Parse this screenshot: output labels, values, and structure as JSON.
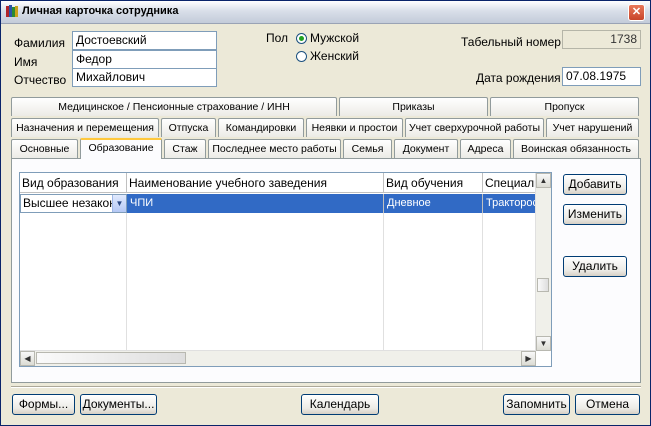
{
  "window": {
    "title": "Личная карточка сотрудника"
  },
  "personal": {
    "surname_label": "Фамилия",
    "surname": "Достоевский",
    "name_label": "Имя",
    "name": "Федор",
    "patronymic_label": "Отчество",
    "patronymic": "Михайлович"
  },
  "gender": {
    "label": "Пол",
    "male": "Мужской",
    "female": "Женский",
    "selected": "male"
  },
  "employee": {
    "number_label": "Табельный номер",
    "number": "1738",
    "birth_label": "Дата рождения",
    "birth_date": "07.08.1975"
  },
  "tabs": {
    "row1": [
      "Медицинское / Пенсионные страхование / ИНН",
      "Приказы",
      "Пропуск"
    ],
    "row2": [
      "Назначения и перемещения",
      "Отпуска",
      "Командировки",
      "Неявки и простои",
      "Учет сверхурочной работы",
      "Учет нарушений"
    ],
    "row3": [
      "Основные",
      "Образование",
      "Стаж",
      "Последнее место работы",
      "Семья",
      "Документ",
      "Адреса",
      "Воинская обязанность"
    ],
    "active": "Образование"
  },
  "education_grid": {
    "columns": [
      "Вид образования",
      "Наименование учебного заведения",
      "Вид обучения",
      "Специальн"
    ],
    "rows": [
      {
        "kind": "Высшее незакон.",
        "institution": "ЧПИ",
        "study_form": "Дневное",
        "specialty": "Тракторос"
      }
    ]
  },
  "side_buttons": {
    "add": "Добавить",
    "edit": "Изменить",
    "delete": "Удалить"
  },
  "footer": {
    "forms": "Формы...",
    "documents": "Документы...",
    "calendar": "Календарь",
    "save": "Запомнить",
    "cancel": "Отмена"
  },
  "colors": {
    "selection": "#316ac5",
    "window_bg": "#ece9d8",
    "title_bar": "#c3cbd9",
    "close_button": "#c8442a"
  }
}
